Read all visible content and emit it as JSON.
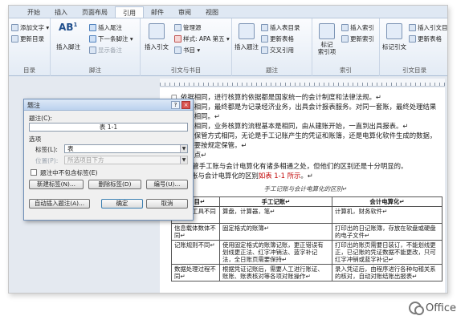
{
  "ribbon": {
    "tabs": [
      "开始",
      "插入",
      "页面布局",
      "引用",
      "邮件",
      "审阅",
      "视图"
    ],
    "active_tab": "引用",
    "toc": {
      "items": [
        "添加文字 ▾",
        "更新目录"
      ],
      "label": "目录"
    },
    "footnote": {
      "big": "插入脚注",
      "items": [
        "插入尾注",
        "下一条脚注 ▾",
        "显示备注"
      ],
      "label": "脚注"
    },
    "citation": {
      "big": "插入引文",
      "items": [
        "管理源",
        "样式: APA 第五 ▾",
        "书目 ▾"
      ],
      "label": "引文与书目"
    },
    "caption": {
      "big": "插入题注",
      "items": [
        "插入表目录",
        "更新表格",
        "交叉引用"
      ],
      "label": "题注"
    },
    "index": {
      "big": "标记\n索引项",
      "items": [
        "插入索引",
        "更新索引"
      ],
      "label": "索引"
    },
    "toa": {
      "big": "标记引文",
      "items": [
        "插入引文目录",
        "更新表格"
      ],
      "label": "引文目录"
    }
  },
  "document": {
    "lines": [
      {
        "num": "□",
        "text": "依据相同，进行核算的依据都是国家统一的会计制度和法律法规。↵"
      },
      {
        "num": "□",
        "text": "结果相同，最终都是为记录经济业务，出具会计报表服务。对同一套账，最终处理结果完全相同。↵"
      },
      {
        "num": "□",
        "text": "流程相同，业务核算的流程基本是相同，由从建账开始，一直到出具报表。↵"
      },
      {
        "num": "□",
        "text": "档案保管方式相同，无论是手工记账产生的凭证和账簿，还是电算化软件生成的数据，均需要按规定保管。↵"
      },
      {
        "num": "2.",
        "text": "不同点↵"
      }
    ],
    "para1": "尽管手工账与会计电算化有诸多相通之处，但他们的区别还是十分明显的。",
    "para2_prefix": "手工记账与会计电算化的区别",
    "para2_ref": "如表 1-1 所示",
    "para2_suffix": "。↵",
    "caption": "手工记账与会计电算化的区别↵",
    "table": {
      "headers": [
        "项 目↵",
        "手工记账↵",
        "会计电算化↵"
      ],
      "rows": [
        [
          "使用的工具不同↵",
          "算盘，计算器，笔↵",
          "计算机，财务软件↵"
        ],
        [
          "信息载体数体不同↵",
          "固定格式的账簿↵",
          "打印出的日记账簿，存放在软盘或硬盘的电子文件↵"
        ],
        [
          "记账规则不同↵",
          "使用固定格式的账簿记账，更正错误有划线更正法、红字冲销法、蓝字补记法，全日账页需要保持↵",
          "打印出的账页需要日装订，不能划线更正，已记账的凭证数据不能更改，只可红字冲销或蓝字补记↵"
        ],
        [
          "数据处理过程不同↵",
          "根据凭证记账后，需要人工进行账证、账账、账表核对等各项对账操作↵",
          "录入凭证后，由程序进行各种勾稽关系的核对，自动对账结账出报表↵"
        ]
      ]
    }
  },
  "dialog": {
    "title": "题注",
    "caption_label": "题注(C):",
    "caption_value": "表 1-1",
    "options_label": "选项",
    "label_label": "标签(L):",
    "label_value": "表",
    "position_label": "位置(P):",
    "position_value": "所选项目下方",
    "exclude_label": "题注中不包含标签(E)",
    "new_label_btn": "新建标签(N)...",
    "delete_label_btn": "删除标签(D)",
    "numbering_btn": "编号(U)...",
    "auto_caption_btn": "自动插入题注(A)...",
    "ok_btn": "确定",
    "cancel_btn": "取消",
    "help_btn": "?",
    "close_btn": "×"
  },
  "watermark": {
    "text": "Office"
  }
}
